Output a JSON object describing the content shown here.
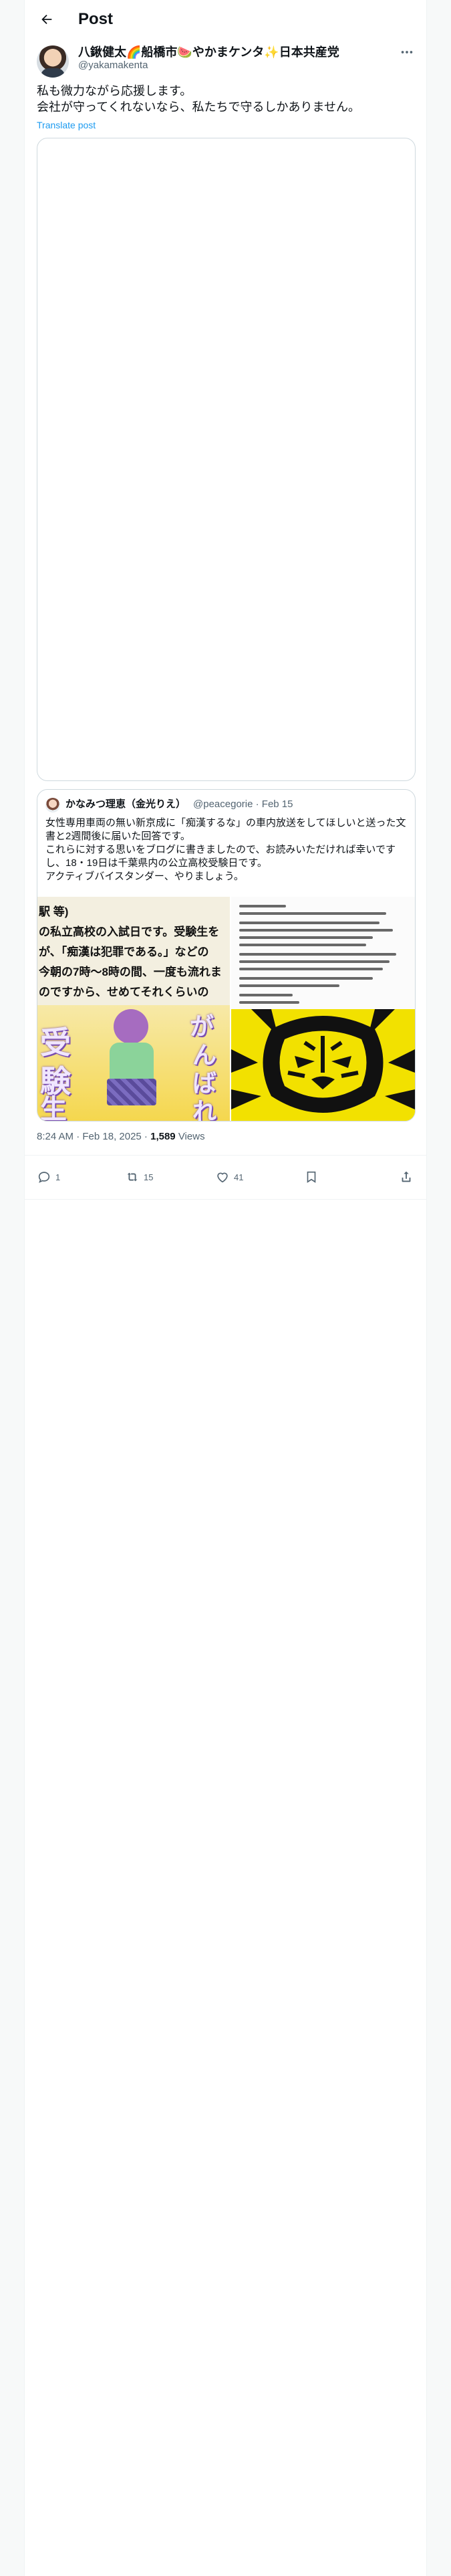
{
  "header": {
    "title": "Post"
  },
  "author": {
    "name": "八鍬健太🌈船橋市🍉やかまケンタ✨日本共産党",
    "handle": "@yakamakenta"
  },
  "tweet": {
    "lines": [
      "私も微力ながら応援します。",
      "会社が守ってくれないなら、私たちで守るしかありません。"
    ],
    "translate_label": "Translate post"
  },
  "quote": {
    "name": "かなみつ理恵（金光りえ）",
    "meta": "@peacegorie · Feb 15",
    "lines": [
      "女性専用車両の無い新京成に「痴漢するな」の車内放送をしてほしいと送った文",
      "書と2週間後に届いた回答です。",
      "これらに対する思いをブログに書きましたので、お読みいただければ幸いです",
      "し、18・19日は千葉県内の公立高校受験日です。",
      "アクティブバイスタンダー、やりましょう。"
    ],
    "image_left_lines": [
      "駅 等)",
      "の私立高校の入試日です。受験生を",
      "が、「痴漢は犯罪である。」などの",
      "今朝の7時〜8時の間、一度も流れま",
      "のですから、せめてそれくらいの"
    ],
    "image_left_kanji": [
      "受",
      "験",
      "生"
    ],
    "image_left_banner": [
      "が",
      "ん",
      "ば",
      "れ"
    ]
  },
  "meta": {
    "time_date": "8:24 AM · Feb 18, 2025 · ",
    "views_count": "1,589",
    "views_label": " Views"
  },
  "actions": {
    "replies": "1",
    "reposts": "15",
    "likes": "41"
  },
  "colors": {
    "link": "#1d9bf0",
    "muted": "#536471",
    "text": "#0f1419"
  }
}
